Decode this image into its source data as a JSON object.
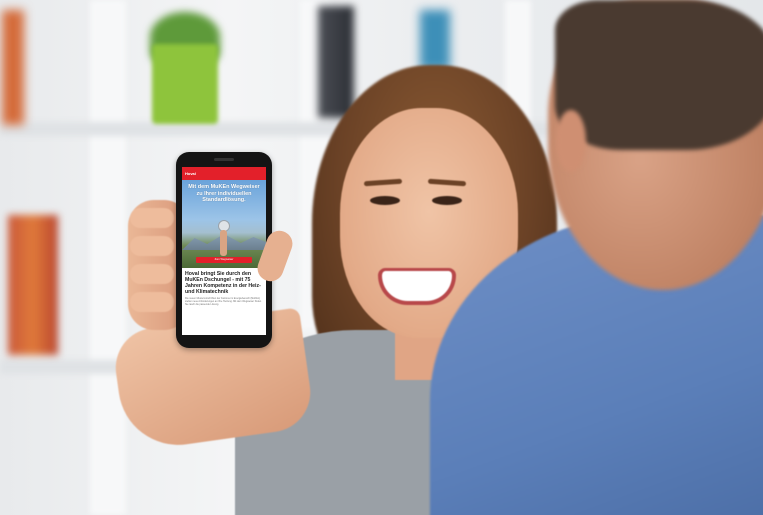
{
  "phone_screen": {
    "brand": "Hoval",
    "headline": "Mit dem MuKEn Wegweiser zu Ihrer individuellen Standardlösung.",
    "cta": "Zum Wegweiser",
    "body_headline": "Hoval bringt Sie durch den MuKEn Dschungel - mit 75 Jahren Kompetenz in der Heiz- und Klimatechnik",
    "body_text": "Die neuen Mustervorschriften der Kantone im Energiebereich (MuKEn) stellen neue Anforderungen an Ihre Heizung. Mit dem Wegweiser finden Sie rasch die passende Lösung."
  },
  "colors": {
    "brand_red": "#e3202a",
    "phone_body": "#141414",
    "man_shirt": "#5b7fb9",
    "woman_shirt": "#9aa0a6"
  }
}
